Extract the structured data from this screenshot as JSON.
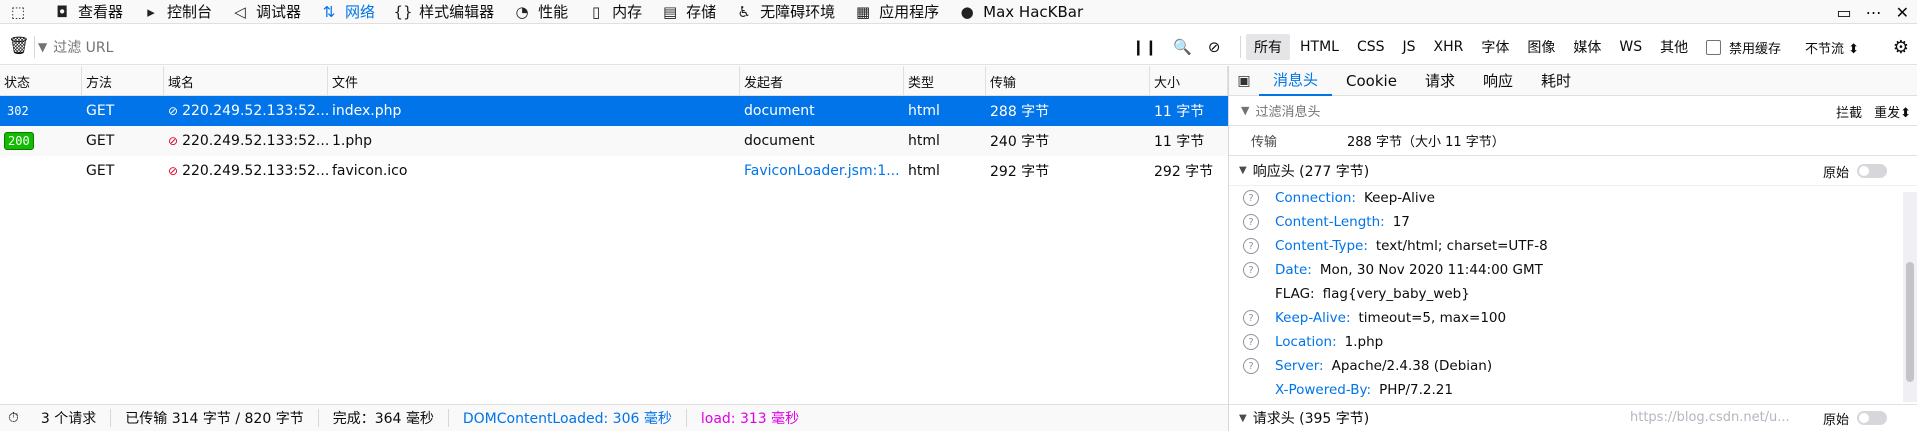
{
  "toolbar": {
    "items": [
      {
        "icon": "inspector-cursor-icon",
        "glyph": "⬚",
        "label": ""
      },
      {
        "icon": "inspector-icon",
        "glyph": "◘",
        "label": "查看器"
      },
      {
        "icon": "console-icon",
        "glyph": "▸",
        "label": "控制台"
      },
      {
        "icon": "debugger-icon",
        "glyph": "◁",
        "label": "调试器"
      },
      {
        "icon": "network-arrows-icon",
        "glyph": "⇅",
        "label": "网络"
      },
      {
        "icon": "style-editor-icon",
        "glyph": "{}",
        "label": "样式编辑器"
      },
      {
        "icon": "performance-gauge-icon",
        "glyph": "◔",
        "label": "性能"
      },
      {
        "icon": "memory-chip-icon",
        "glyph": "▯",
        "label": "内存"
      },
      {
        "icon": "storage-icon",
        "glyph": "▤",
        "label": "存储"
      },
      {
        "icon": "accessibility-person-icon",
        "glyph": "♿",
        "label": "无障碍环境"
      },
      {
        "icon": "application-grid-icon",
        "glyph": "▦",
        "label": "应用程序"
      },
      {
        "icon": "hackbar-icon",
        "glyph": "●",
        "label": "Max HacKBar"
      }
    ],
    "active_label": "网络"
  },
  "filterbar": {
    "url_placeholder": "过滤 URL",
    "type_filters": [
      "所有",
      "HTML",
      "CSS",
      "JS",
      "XHR",
      "字体",
      "图像",
      "媒体",
      "WS",
      "其他"
    ],
    "selected_type": "所有",
    "disable_cache_label": "禁用缓存",
    "throttle_label": "不节流 ⬍"
  },
  "table": {
    "columns": [
      "状态",
      "方法",
      "域名",
      "文件",
      "发起者",
      "类型",
      "传输",
      "大小"
    ],
    "rows": [
      {
        "status": "302",
        "method": "GET",
        "domain": "220.249.52.133:52...",
        "file": "index.php",
        "initiator": "document",
        "type": "html",
        "transfer": "288 字节",
        "size": "11 字节"
      },
      {
        "status": "200",
        "method": "GET",
        "domain": "220.249.52.133:52...",
        "file": "1.php",
        "initiator": "document",
        "type": "html",
        "transfer": "240 字节",
        "size": "11 字节"
      },
      {
        "status": "",
        "method": "GET",
        "domain": "220.249.52.133:52...",
        "file": "favicon.ico",
        "initiator": "FaviconLoader.jsm:1...",
        "type": "html",
        "transfer": "292 字节",
        "size": "292 字节"
      }
    ]
  },
  "panel": {
    "tabs": [
      "消息头",
      "Cookie",
      "请求",
      "响应",
      "耗时"
    ],
    "active_tab": "消息头",
    "filter_placeholder": "过滤消息头",
    "block_label": "拦截",
    "resend_label": "重发⬍",
    "transfer_key": "传输",
    "transfer_value": "288 字节（大小 11 字节）",
    "response_section": "响应头 (277 字节)",
    "raw_label": "原始",
    "response_headers": [
      {
        "key": "Connection:",
        "value": "Keep-Alive",
        "help": true
      },
      {
        "key": "Content-Length:",
        "value": "17",
        "help": true
      },
      {
        "key": "Content-Type:",
        "value": "text/html; charset=UTF-8",
        "help": true
      },
      {
        "key": "Date:",
        "value": "Mon, 30 Nov 2020 11:44:00 GMT",
        "help": true
      },
      {
        "key": "FLAG:",
        "value": "flag{very_baby_web}",
        "help": false
      },
      {
        "key": "Keep-Alive:",
        "value": "timeout=5, max=100",
        "help": true
      },
      {
        "key": "Location:",
        "value": "1.php",
        "help": true
      },
      {
        "key": "Server:",
        "value": "Apache/2.4.38 (Debian)",
        "help": true
      },
      {
        "key": "X-Powered-By:",
        "value": "PHP/7.2.21",
        "help": false
      }
    ],
    "request_section": "请求头 (395 字节)"
  },
  "statusbar": {
    "requests": "3 个请求",
    "transferred": "已传输 314 字节 / 820 字节",
    "finish": "完成：364 毫秒",
    "dcl": "DOMContentLoaded: 306 毫秒",
    "load": "load: 313 毫秒",
    "watermark": "https://blog.csdn.net/u..."
  },
  "colors": {
    "accent": "#0074e8",
    "selected_row": "#0074e8",
    "ok_badge": "#12bc00",
    "load": "#e200e7"
  }
}
